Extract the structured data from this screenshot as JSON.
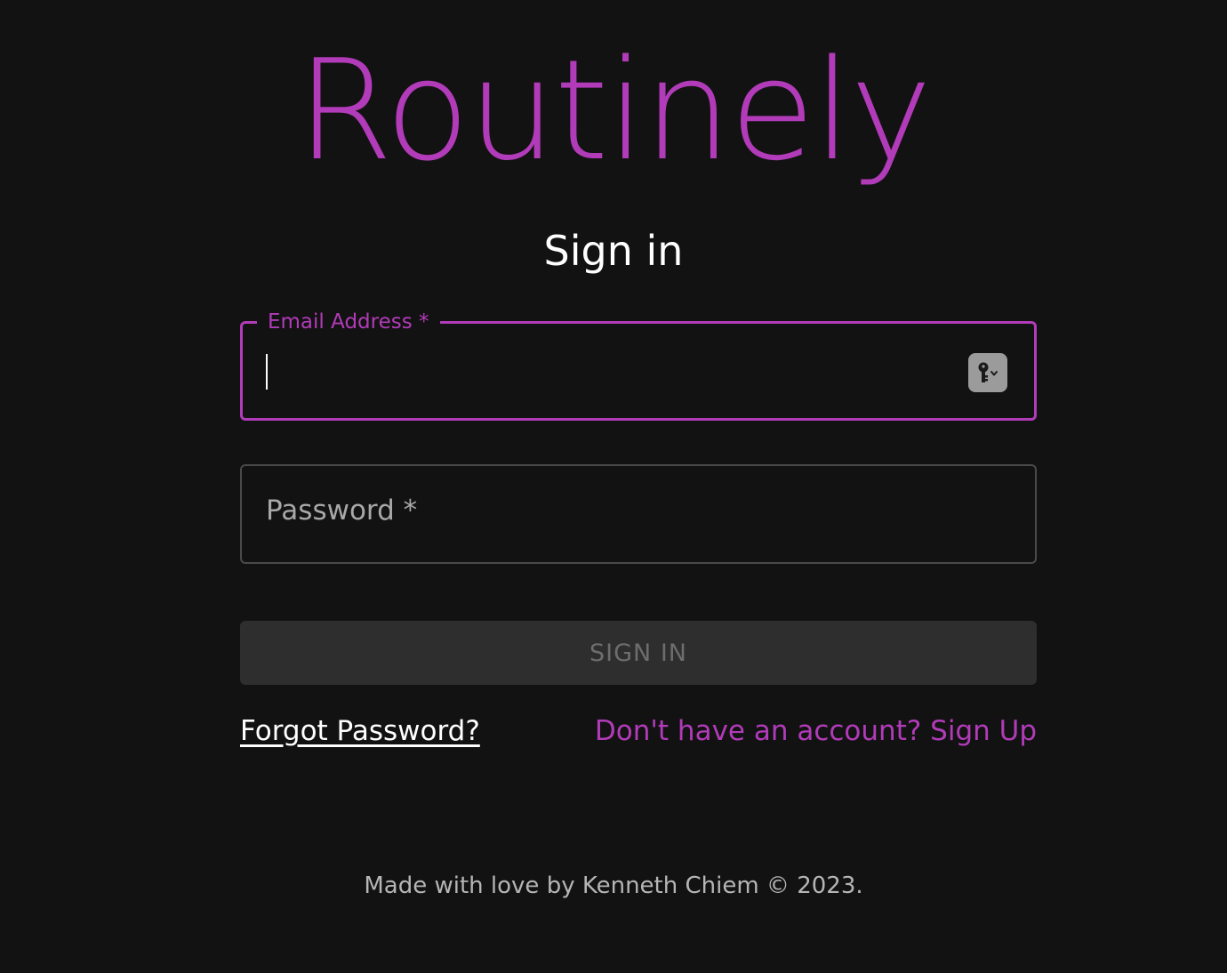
{
  "brand": {
    "name": "Routinely",
    "color": "#b13bb8"
  },
  "page_title": "Sign in",
  "form": {
    "email": {
      "label": "Email Address *",
      "value": ""
    },
    "password": {
      "label": "Password *",
      "value": ""
    },
    "submit_label": "SIGN IN"
  },
  "links": {
    "forgot_password": "Forgot Password?",
    "sign_up": "Don't have an account? Sign Up"
  },
  "footer": {
    "text": "Made with love by Kenneth Chiem © 2023."
  },
  "icons": {
    "password_manager": "key-icon"
  },
  "colors": {
    "background": "#121212",
    "accent": "#b13bb8",
    "button_bg": "#2e2e2e"
  }
}
